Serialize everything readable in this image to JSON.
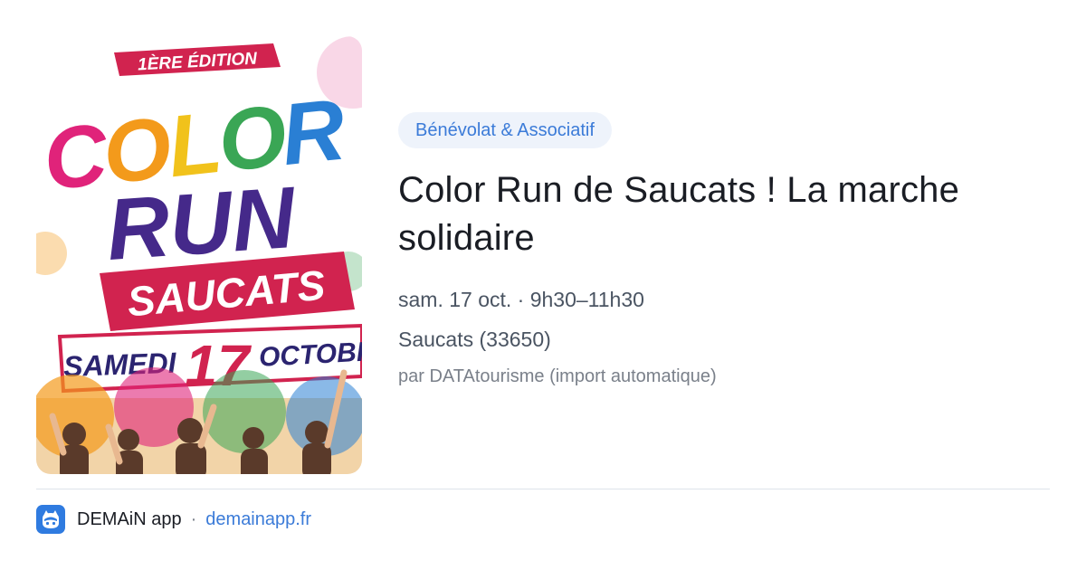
{
  "poster": {
    "edition": "1ÈRE ÉDITION",
    "word1": "COLOR",
    "word2": "RUN",
    "town": "SAUCATS",
    "day_name": "SAMEDI",
    "day_number": "17",
    "month": "OCTOBR",
    "colors": {
      "magenta": "#e0237a",
      "orange": "#f39a1b",
      "green": "#3aa655",
      "blue": "#2a7fd4",
      "purple": "#45298a",
      "crimson": "#c41f4a"
    }
  },
  "event": {
    "category": "Bénévolat & Associatif",
    "title": "Color Run de Saucats ! La marche solidaire",
    "datetime": "sam. 17 oct. · 9h30–11h30",
    "location": "Saucats (33650)",
    "source": "par DATAtourisme (import automatique)"
  },
  "footer": {
    "app_icon": "demain-app-icon",
    "app_name": "DEMAiN app",
    "separator": "·",
    "url": "demainapp.fr"
  },
  "colors": {
    "badge_bg": "#eef3fb",
    "accent": "#3b7bd8",
    "title_text": "#1a1d24",
    "body_text": "#4a5462",
    "muted_text": "#7a808a"
  }
}
